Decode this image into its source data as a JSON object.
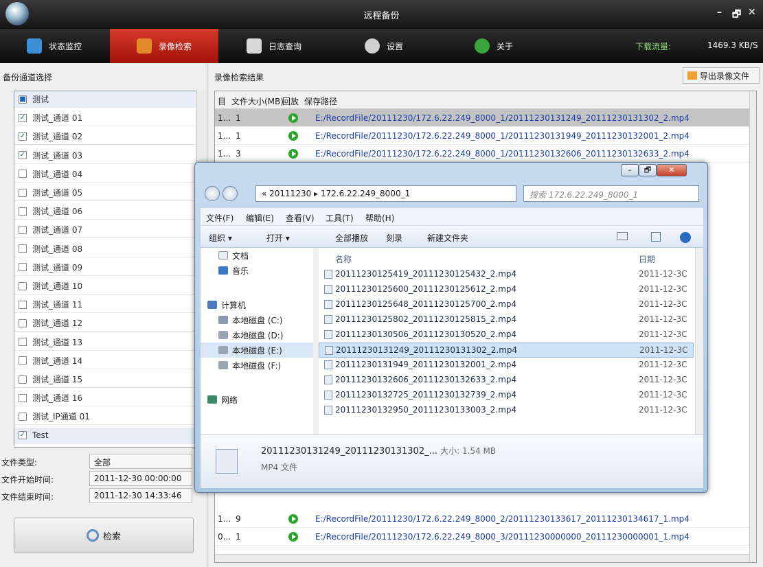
{
  "window": {
    "title": "远程备份",
    "minimize": "–",
    "maximize": "🗗",
    "close": "✕"
  },
  "tabs": [
    {
      "label": "状态监控",
      "icon": "monitor-icon",
      "color": "#3a8fd6"
    },
    {
      "label": "录像检索",
      "icon": "video-search-icon",
      "color": "#e38b2a"
    },
    {
      "label": "日志查询",
      "icon": "log-icon",
      "color": "#d8d8d8"
    },
    {
      "label": "设置",
      "icon": "gear-icon",
      "color": "#cfcfcf"
    },
    {
      "label": "关于",
      "icon": "info-icon",
      "color": "#3aa53a"
    }
  ],
  "status": {
    "download_label": "下载流量:",
    "download_value": "1469.3 KB/S"
  },
  "left": {
    "title": "备份通道选择",
    "channels": [
      {
        "label": "测试",
        "checked": "partial",
        "group": true
      },
      {
        "label": "测试_通道 01",
        "checked": true
      },
      {
        "label": "测试_通道 02",
        "checked": true
      },
      {
        "label": "测试_通道 03",
        "checked": true
      },
      {
        "label": "测试_通道 04",
        "checked": false
      },
      {
        "label": "测试_通道 05",
        "checked": false
      },
      {
        "label": "测试_通道 06",
        "checked": false
      },
      {
        "label": "测试_通道 07",
        "checked": false
      },
      {
        "label": "测试_通道 08",
        "checked": false
      },
      {
        "label": "测试_通道 09",
        "checked": false
      },
      {
        "label": "测试_通道 10",
        "checked": false
      },
      {
        "label": "测试_通道 11",
        "checked": false
      },
      {
        "label": "测试_通道 12",
        "checked": false
      },
      {
        "label": "测试_通道 13",
        "checked": false
      },
      {
        "label": "测试_通道 14",
        "checked": false
      },
      {
        "label": "测试_通道 15",
        "checked": false
      },
      {
        "label": "测试_通道 16",
        "checked": false
      },
      {
        "label": "测试_IP通道 01",
        "checked": false
      },
      {
        "label": "Test",
        "checked": true,
        "group": true
      }
    ],
    "file_type_label": "文件类型:",
    "file_type_value": "全部",
    "start_label": "文件开始时间:",
    "start_value": "2011-12-30 00:00:00",
    "end_label": "文件结束时间:",
    "end_value": "2011-12-30 14:33:46",
    "search_label": "检索"
  },
  "right": {
    "title": "录像检索结果",
    "export_label": "导出录像文件",
    "columns": [
      "目",
      "文件大小(MB)",
      "回放",
      "保存路径"
    ],
    "rows": [
      {
        "idx": "1...",
        "size": "1",
        "path": "E:/RecordFile/20111230/172.6.22.249_8000_1/20111230131249_20111230131302_2.mp4",
        "selected": true
      },
      {
        "idx": "1...",
        "size": "1",
        "path": "E:/RecordFile/20111230/172.6.22.249_8000_1/20111230131949_20111230132001_2.mp4",
        "selected": false
      },
      {
        "idx": "1...",
        "size": "3",
        "path": "E:/RecordFile/20111230/172.6.22.249_8000_1/20111230132606_20111230132633_2.mp4",
        "selected": false
      }
    ],
    "rows_bottom": [
      {
        "idx": "1...",
        "size": "9",
        "path": "E:/RecordFile/20111230/172.6.22.249_8000_2/20111230133617_20111230134617_1.mp4"
      },
      {
        "idx": "0...",
        "size": "1",
        "path": "E:/RecordFile/20111230/172.6.22.249_8000_3/20111230000000_20111230000001_1.mp4"
      }
    ]
  },
  "explorer": {
    "address": "« 20111230 ▸ 172.6.22.249_8000_1",
    "search_placeholder": "搜索 172.6.22.249_8000_1",
    "menu": [
      "文件(F)",
      "编辑(E)",
      "查看(V)",
      "工具(T)",
      "帮助(H)"
    ],
    "toolbar": [
      "组织 ▾",
      "打开 ▾",
      "全部播放",
      "刻录",
      "新建文件夹"
    ],
    "nav": [
      {
        "label": "文档",
        "icon": "document-icon"
      },
      {
        "label": "音乐",
        "icon": "music-icon"
      },
      {
        "label": "计算机",
        "icon": "computer-icon"
      },
      {
        "label": "本地磁盘 (C:)",
        "icon": "drive-icon"
      },
      {
        "label": "本地磁盘 (D:)",
        "icon": "drive-icon"
      },
      {
        "label": "本地磁盘 (E:)",
        "icon": "drive-icon",
        "selected": true
      },
      {
        "label": "本地磁盘 (F:)",
        "icon": "drive-icon"
      },
      {
        "label": "网络",
        "icon": "network-icon"
      }
    ],
    "col_name": "名称",
    "col_date": "日期",
    "files": [
      {
        "name": "20111230125419_20111230125432_2.mp4",
        "date": "2011-12-3C"
      },
      {
        "name": "20111230125600_20111230125612_2.mp4",
        "date": "2011-12-3C"
      },
      {
        "name": "20111230125648_20111230125700_2.mp4",
        "date": "2011-12-3C"
      },
      {
        "name": "20111230125802_20111230125815_2.mp4",
        "date": "2011-12-3C"
      },
      {
        "name": "20111230130506_20111230130520_2.mp4",
        "date": "2011-12-3C"
      },
      {
        "name": "20111230131249_20111230131302_2.mp4",
        "date": "2011-12-3C",
        "selected": true
      },
      {
        "name": "20111230131949_20111230132001_2.mp4",
        "date": "2011-12-3C"
      },
      {
        "name": "20111230132606_20111230132633_2.mp4",
        "date": "2011-12-3C"
      },
      {
        "name": "20111230132725_20111230132739_2.mp4",
        "date": "2011-12-3C"
      },
      {
        "name": "20111230132950_20111230133003_2.mp4",
        "date": "2011-12-3C"
      }
    ],
    "detail_name": "20111230131249_20111230131302_...",
    "detail_size": "大小: 1.54 MB",
    "detail_type": "MP4 文件"
  }
}
